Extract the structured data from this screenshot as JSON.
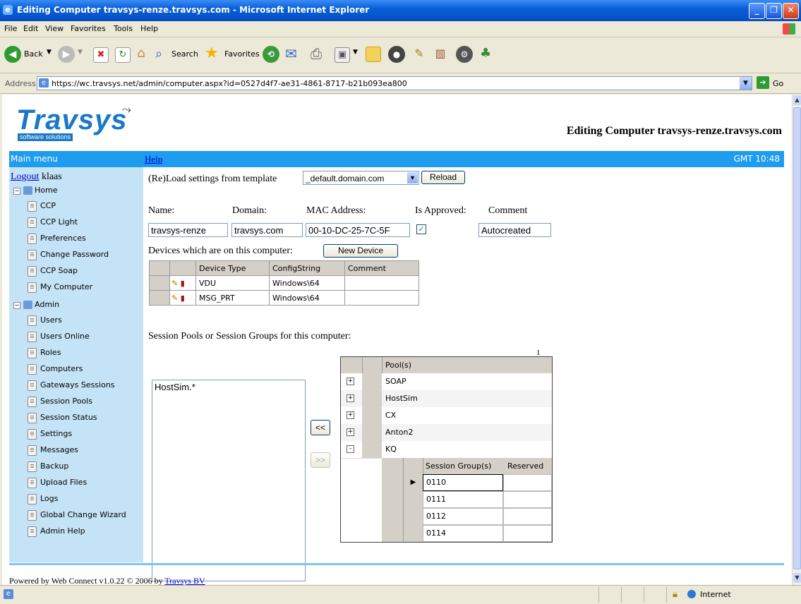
{
  "window": {
    "title": "Editing Computer travsys-renze.travsys.com - Microsoft Internet Explorer"
  },
  "menu": [
    "File",
    "Edit",
    "View",
    "Favorites",
    "Tools",
    "Help"
  ],
  "toolbar": {
    "back": "Back",
    "search": "Search",
    "favorites": "Favorites"
  },
  "address": {
    "label": "Address",
    "url": "https://wc.travsys.net/admin/computer.aspx?id=0527d4f7-ae31-4861-8717-b21b093ea800",
    "go": "Go"
  },
  "header": {
    "logo": "Travsys",
    "logo_sub": "software solutions",
    "page_title": "Editing Computer travsys-renze.travsys.com"
  },
  "bluebar": {
    "main_menu": "Main menu",
    "help": "Help",
    "time": "GMT 10:48"
  },
  "sidebar": {
    "logout": "Logout",
    "user": "klaas",
    "home": "Home",
    "home_items": [
      "CCP",
      "CCP Light",
      "Preferences",
      "Change Password",
      "CCP Soap",
      "My Computer"
    ],
    "admin": "Admin",
    "admin_items": [
      "Users",
      "Users Online",
      "Roles",
      "Computers",
      "Gateways Sessions",
      "Session Pools",
      "Session Status",
      "Settings",
      "Messages",
      "Backup",
      "Upload Files",
      "Logs",
      "Global Change Wizard",
      "Admin Help"
    ]
  },
  "form": {
    "reload_label": "(Re)Load settings from template",
    "template_value": "_default.domain.com",
    "reload_button": "Reload",
    "name_label": "Name:",
    "domain_label": "Domain:",
    "mac_label": "MAC Address:",
    "approved_label": "Is Approved:",
    "comment_label": "Comment",
    "name_value": "travsys-renze",
    "domain_value": "travsys.com",
    "mac_value": "00-10-DC-25-7C-5F",
    "comment_value": "Autocreated",
    "devices_label": "Devices which are on this computer:",
    "new_device_button": "New Device"
  },
  "devices": {
    "headers": [
      "Device Type",
      "ConfigString",
      "Comment"
    ],
    "rows": [
      {
        "type": "VDU",
        "config": "Windows\\64",
        "comment": ""
      },
      {
        "type": "MSG_PRT",
        "config": "Windows\\64",
        "comment": ""
      }
    ]
  },
  "sessions": {
    "label": "Session Pools or Session Groups for this computer:",
    "page_number": "1",
    "selected_list": [
      "HostSim.*"
    ],
    "add_button": "<<",
    "remove_button": ">>",
    "pool_header": "Pool(s)",
    "pools": [
      {
        "expander": "+",
        "name": "SOAP"
      },
      {
        "expander": "+",
        "name": "HostSim"
      },
      {
        "expander": "+",
        "name": "CX"
      },
      {
        "expander": "+",
        "name": "Anton2"
      },
      {
        "expander": "-",
        "name": "KQ"
      }
    ],
    "group_header": "Session Group(s)",
    "reserved_header": "Reserved",
    "groups": [
      "0110",
      "0111",
      "0112",
      "0114"
    ]
  },
  "footer": {
    "text": "Powered by Web Connect v1.0.22 © 2006 by",
    "link": "Travsys BV"
  },
  "status": {
    "zone": "Internet"
  }
}
